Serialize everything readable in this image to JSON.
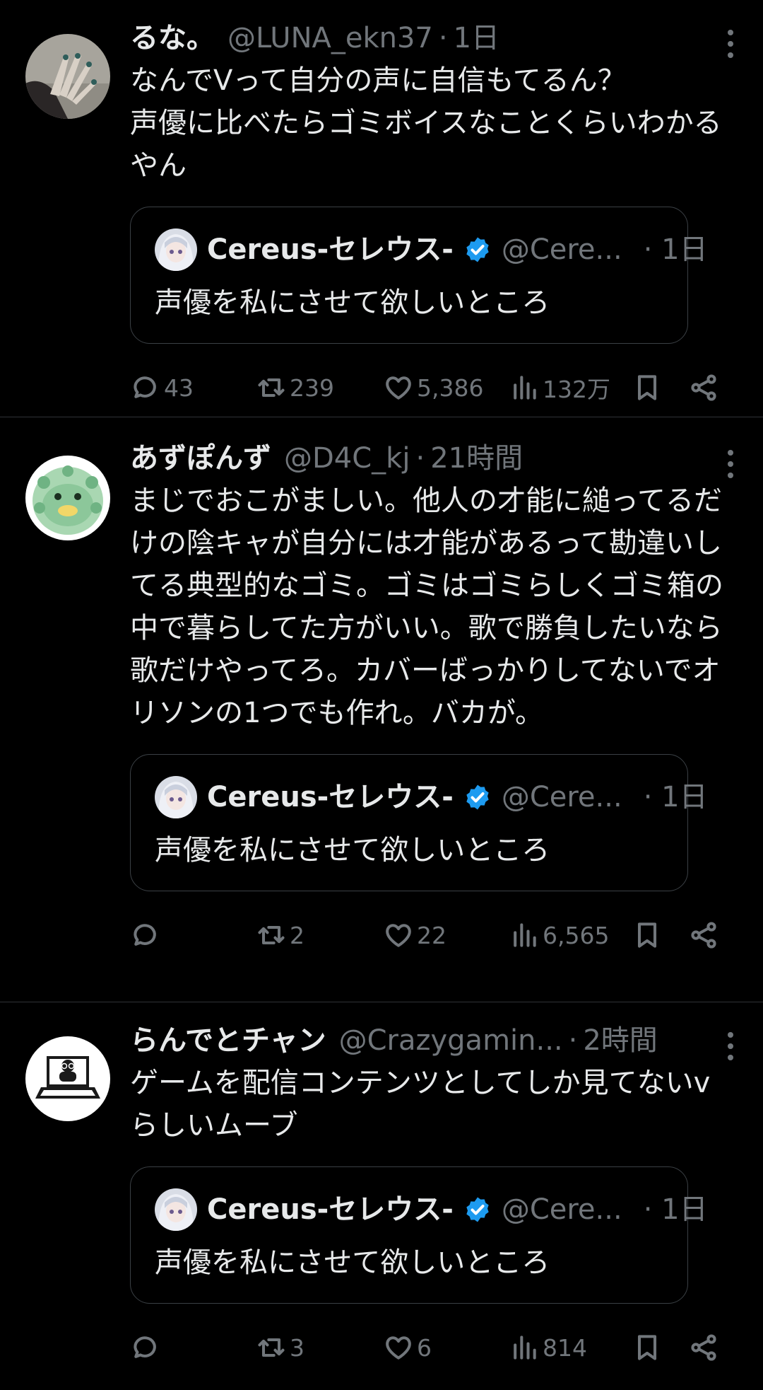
{
  "quoted": {
    "name": "Cereus-セレウス-",
    "handle": "@Cere...",
    "time": "1日",
    "text": "声優を私にさせて欲しいところ"
  },
  "tweets": [
    {
      "name": "るな。",
      "handle": "@LUNA_ekn37",
      "time": "1日",
      "text": "なんでVって自分の声に自信もてるん？\n声優に比べたらゴミボイスなことくらいわかるやん",
      "replies": "43",
      "retweets": "239",
      "likes": "5,386",
      "views": "132万"
    },
    {
      "name": "あずぽんず",
      "handle": "@D4C_kj",
      "time": "21時間",
      "text": "まじでおこがましい。他人の才能に縋ってるだけの陰キャが自分には才能があるって勘違いしてる典型的なゴミ。ゴミはゴミらしくゴミ箱の中で暮らしてた方がいい。歌で勝負したいなら歌だけやってろ。カバーばっかりしてないでオリソンの1つでも作れ。バカが。",
      "replies": "",
      "retweets": "2",
      "likes": "22",
      "views": "6,565"
    },
    {
      "name": "らんでとチャン",
      "handle": "@Crazygamin...",
      "time": "2時間",
      "text": "ゲームを配信コンテンツとしてしか見てないvらしいムーブ",
      "replies": "",
      "retweets": "3",
      "likes": "6",
      "views": "814"
    }
  ],
  "separator": "·",
  "icons": {
    "more": "more-dots-icon",
    "reply": "reply-bubble-icon",
    "retweet": "retweet-icon",
    "like": "heart-icon",
    "views": "views-bar-chart-icon",
    "bookmark": "bookmark-icon",
    "share": "share-icon",
    "verified": "verified-badge-icon"
  },
  "colors": {
    "background": "#000000",
    "text": "#e7e9ea",
    "muted": "#71767b",
    "verified": "#1d9bf0",
    "divider": "#2f3336"
  }
}
